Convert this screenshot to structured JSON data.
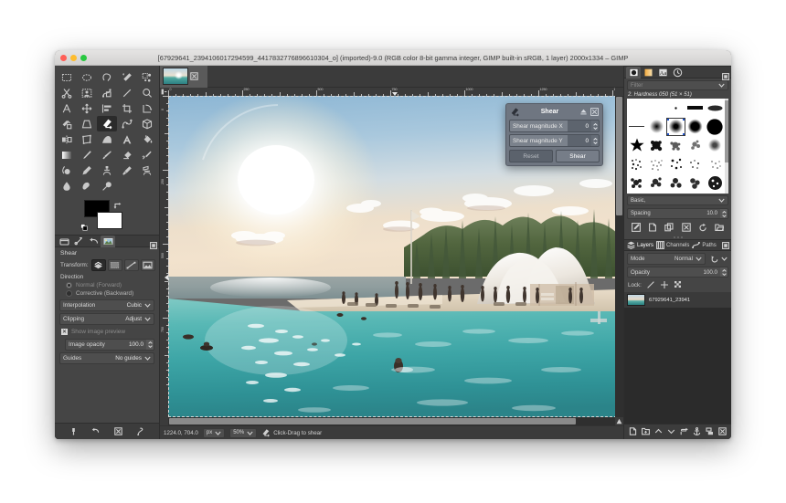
{
  "window": {
    "title": "[67929641_2394106017294599_4417832776896610304_o] (imported)-9.0 (RGB color 8-bit gamma integer, GIMP built-in sRGB, 1 layer) 2000x1334 – GIMP",
    "traffic": {
      "close": "close-button",
      "minimize": "minimize-button",
      "zoom": "zoom-button"
    }
  },
  "toolbox": {
    "tools": [
      {
        "name": "rect-select-tool",
        "label": "Rectangle Select"
      },
      {
        "name": "ellipse-select-tool",
        "label": "Ellipse Select"
      },
      {
        "name": "free-select-tool",
        "label": "Free Select"
      },
      {
        "name": "fuzzy-select-tool",
        "label": "Fuzzy Select"
      },
      {
        "name": "select-by-color-tool",
        "label": "Select by Color"
      },
      {
        "name": "scissors-select-tool",
        "label": "Scissors Select"
      },
      {
        "name": "foreground-select-tool",
        "label": "Foreground Select"
      },
      {
        "name": "paths-tool",
        "label": "Paths"
      },
      {
        "name": "measure-tool",
        "label": "Measure"
      },
      {
        "name": "zoom-tool",
        "label": "Zoom"
      },
      {
        "name": "unified-transform-tool",
        "label": "Unified Transform"
      },
      {
        "name": "move-tool",
        "label": "Move"
      },
      {
        "name": "align-tool",
        "label": "Alignment"
      },
      {
        "name": "crop-tool",
        "label": "Crop"
      },
      {
        "name": "rotate-tool",
        "label": "Rotate"
      },
      {
        "name": "scale-tool",
        "label": "Scale"
      },
      {
        "name": "perspective-tool",
        "label": "Perspective"
      },
      {
        "name": "shear-tool",
        "label": "Shear"
      },
      {
        "name": "handle-transform-tool",
        "label": "Handle Transform"
      },
      {
        "name": "3d-transform-tool",
        "label": "3D Transform"
      },
      {
        "name": "flip-tool",
        "label": "Flip"
      },
      {
        "name": "cage-transform-tool",
        "label": "Cage Transform"
      },
      {
        "name": "warp-transform-tool",
        "label": "Warp Transform"
      },
      {
        "name": "text-tool",
        "label": "Text"
      },
      {
        "name": "bucket-fill-tool",
        "label": "Bucket Fill"
      },
      {
        "name": "gradient-tool",
        "label": "Gradient"
      },
      {
        "name": "pencil-tool",
        "label": "Pencil"
      },
      {
        "name": "paintbrush-tool",
        "label": "Paintbrush"
      },
      {
        "name": "eraser-tool",
        "label": "Eraser"
      },
      {
        "name": "airbrush-tool",
        "label": "Airbrush"
      },
      {
        "name": "ink-tool",
        "label": "Ink"
      },
      {
        "name": "mypaint-brush-tool",
        "label": "MyPaint Brush"
      },
      {
        "name": "clone-tool",
        "label": "Clone"
      },
      {
        "name": "heal-tool",
        "label": "Heal"
      },
      {
        "name": "perspective-clone-tool",
        "label": "Perspective Clone"
      },
      {
        "name": "blur-sharpen-tool",
        "label": "Blur / Sharpen"
      },
      {
        "name": "smudge-tool",
        "label": "Smudge"
      },
      {
        "name": "dodge-burn-tool",
        "label": "Dodge / Burn"
      }
    ],
    "active_tool_index": 17,
    "colors": {
      "foreground": "#000000",
      "background": "#ffffff"
    },
    "swap_icon": "swap-colors-icon",
    "reset_icon": "reset-colors-icon"
  },
  "tool_options": {
    "dock_tabs": [
      {
        "name": "tool-options-tab",
        "icon": "tool-options-icon",
        "active": false
      },
      {
        "name": "device-status-tab",
        "icon": "device-status-icon",
        "active": false
      },
      {
        "name": "undo-history-tab",
        "icon": "undo-history-icon",
        "active": false
      },
      {
        "name": "images-tab",
        "icon": "images-icon",
        "active": true
      }
    ],
    "title": "Shear",
    "transform_label": "Transform:",
    "transform_buttons": [
      {
        "name": "transform-layer-button",
        "icon": "layer-icon",
        "active": true
      },
      {
        "name": "transform-selection-button",
        "icon": "selection-icon",
        "active": false
      },
      {
        "name": "transform-path-button",
        "icon": "path-icon",
        "active": false
      },
      {
        "name": "transform-image-button",
        "icon": "image-icon",
        "active": false
      }
    ],
    "direction_label": "Direction",
    "direction_options": [
      {
        "label": "Normal (Forward)",
        "selected": true
      },
      {
        "label": "Corrective (Backward)",
        "selected": false
      }
    ],
    "interpolation_label": "Interpolation",
    "interpolation_value": "Cubic",
    "clipping_label": "Clipping",
    "clipping_value": "Adjust",
    "show_image_preview_label": "Show image preview",
    "show_image_preview_checked": true,
    "image_opacity_label": "Image opacity",
    "image_opacity_value": "100.0",
    "guides_label": "Guides",
    "guides_value": "No guides",
    "bottom_buttons": [
      {
        "name": "save-tool-preset-button",
        "icon": "save-icon"
      },
      {
        "name": "restore-tool-preset-button",
        "icon": "restore-icon"
      },
      {
        "name": "delete-tool-preset-button",
        "icon": "delete-icon"
      },
      {
        "name": "reset-tool-options-button",
        "icon": "reset-icon"
      }
    ]
  },
  "image_tab": {
    "name": "image-tab",
    "thumbnail": "image-thumbnail",
    "close_icon": "close-tab-icon"
  },
  "canvas": {
    "h_ruler_ticks": [
      "0",
      "250",
      "500",
      "750",
      "1000",
      "1250",
      "1500"
    ],
    "v_ruler_ticks": [
      "0",
      "250",
      "500",
      "750"
    ],
    "zoom_anchor_icon": "navigate-image-icon"
  },
  "statusbar": {
    "pointer_position": "1224.0, 704.0",
    "unit": "px",
    "zoom": "50%",
    "hint_icon": "shear-tool-icon",
    "hint": "Click-Drag to shear"
  },
  "shear_dialog": {
    "icon": "shear-tool-icon",
    "title": "Shear",
    "collapse_icon": "collapse-icon",
    "close_icon": "close-icon",
    "fields": [
      {
        "label": "Shear magnitude X",
        "value": "0"
      },
      {
        "label": "Shear magnitude Y",
        "value": "0"
      }
    ],
    "reset_label": "Reset",
    "confirm_label": "Shear"
  },
  "brushes": {
    "tabs": [
      {
        "name": "brushes-tab",
        "icon": "brush-icon",
        "active": true
      },
      {
        "name": "gradients-tab",
        "icon": "gradient-icon",
        "active": false
      },
      {
        "name": "fonts-tab",
        "icon": "font-icon",
        "active": false
      },
      {
        "name": "document-history-tab",
        "icon": "history-icon",
        "active": false
      }
    ],
    "menu_icon": "dock-menu-icon",
    "filter_placeholder": "Filter",
    "selected_brush": "2. Hardness 050 (51 × 51)",
    "tag_value": "Basic,",
    "spacing_label": "Spacing",
    "spacing_value": "10.0",
    "buttons": [
      {
        "name": "edit-brush-button",
        "icon": "edit-icon"
      },
      {
        "name": "new-brush-button",
        "icon": "new-icon"
      },
      {
        "name": "duplicate-brush-button",
        "icon": "duplicate-icon"
      },
      {
        "name": "delete-brush-button",
        "icon": "delete-icon"
      },
      {
        "name": "refresh-brushes-button",
        "icon": "refresh-icon"
      },
      {
        "name": "open-brush-as-image-button",
        "icon": "open-icon"
      }
    ]
  },
  "layers": {
    "tabs": [
      {
        "name": "layers-tab",
        "label": "Layers",
        "icon": "layers-icon",
        "active": true
      },
      {
        "name": "channels-tab",
        "label": "Channels",
        "icon": "channels-icon",
        "active": false
      },
      {
        "name": "paths-tab",
        "label": "Paths",
        "icon": "paths-icon",
        "active": false
      }
    ],
    "menu_icon": "dock-menu-icon",
    "mode_label": "Mode",
    "mode_value": "Normal",
    "mode_reset_icon": "reset-mode-icon",
    "opacity_label": "Opacity",
    "opacity_value": "100.0",
    "lock_label": "Lock:",
    "lock_icons": [
      "lock-pixels-icon",
      "lock-position-icon",
      "lock-alpha-icon"
    ],
    "items": [
      {
        "name": "67929641_23941",
        "visible": true,
        "thumbnail": "layer-thumbnail"
      }
    ],
    "buttons": [
      {
        "name": "new-layer-button",
        "icon": "new-layer-icon"
      },
      {
        "name": "new-layer-group-button",
        "icon": "new-group-icon"
      },
      {
        "name": "raise-layer-button",
        "icon": "raise-icon"
      },
      {
        "name": "lower-layer-button",
        "icon": "lower-icon"
      },
      {
        "name": "duplicate-layer-button",
        "icon": "duplicate-layer-icon"
      },
      {
        "name": "anchor-layer-button",
        "icon": "anchor-icon"
      },
      {
        "name": "merge-down-button",
        "icon": "merge-icon"
      },
      {
        "name": "delete-layer-button",
        "icon": "delete-layer-icon"
      }
    ]
  }
}
